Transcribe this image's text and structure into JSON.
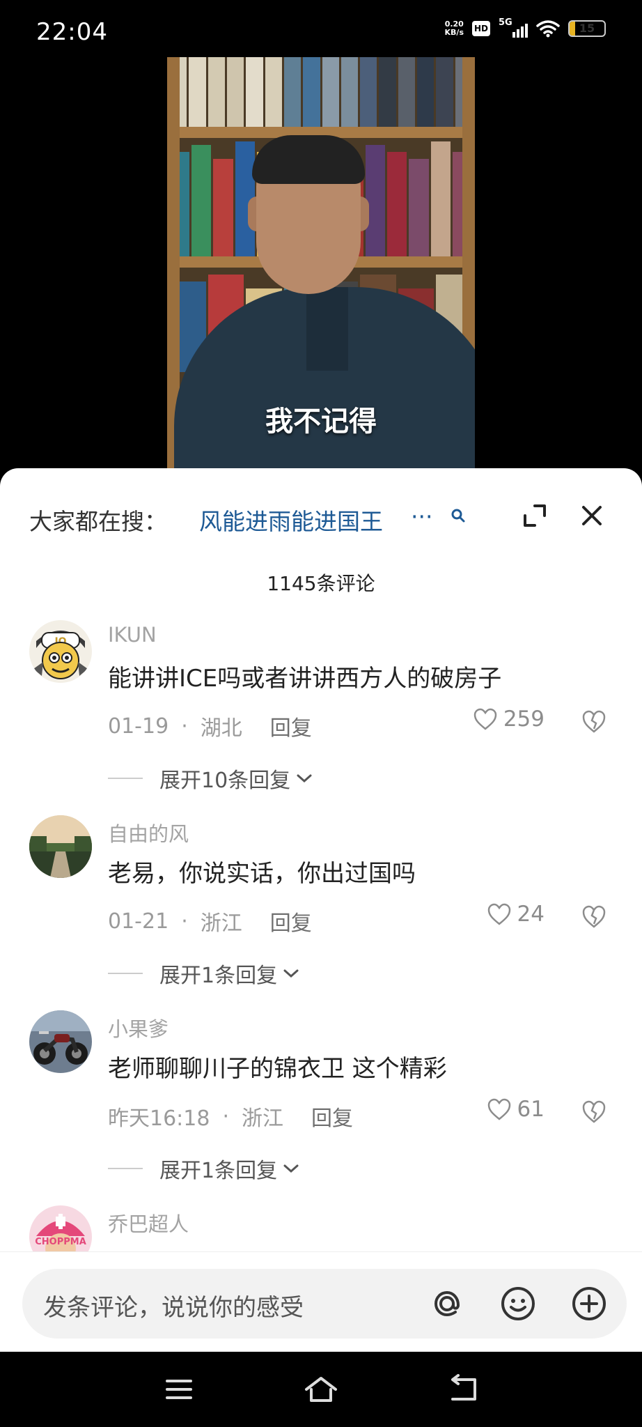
{
  "status_bar": {
    "time": "22:04",
    "net_speed_value": "0.20",
    "net_speed_unit": "KB/s",
    "hd_badge": "HD",
    "network_type": "5G",
    "battery_level": "15",
    "battery_fraction": 0.15,
    "battery_color": "#e8b423"
  },
  "video": {
    "subtitle": "我不记得"
  },
  "search": {
    "prefix": "大家都在搜：",
    "query": "风能进雨能进国王",
    "ellipsis": "···",
    "icon": "search-icon",
    "link_color": "#1e5a95"
  },
  "sheet_controls": {
    "expand_icon": "expand-icon",
    "close_icon": "close-icon"
  },
  "comments_header": {
    "count_label": "1145条评论"
  },
  "comments": [
    {
      "username": "IKUN",
      "avatar_icon": "cartoon-avatar",
      "text": "能讲讲ICE吗或者讲讲西方人的破房子",
      "date": "01-19",
      "dot": "·",
      "location": "湖北",
      "reply_label": "回复",
      "likes": "259",
      "expand_label": "展开10条回复"
    },
    {
      "username": "自由的风",
      "avatar_icon": "sunset-river-avatar",
      "text": "老易，你说实话，你出过国吗",
      "date": "01-21",
      "dot": "·",
      "location": "浙江",
      "reply_label": "回复",
      "likes": "24",
      "expand_label": "展开1条回复"
    },
    {
      "username": "小果爹",
      "avatar_icon": "motorcycle-avatar",
      "text": "老师聊聊川子的锦衣卫 这个精彩",
      "date": "昨天16:18",
      "dot": "·",
      "location": "浙江",
      "reply_label": "回复",
      "likes": "61",
      "expand_label": "展开1条回复"
    },
    {
      "username": "乔巴超人",
      "avatar_icon": "chopper-avatar",
      "avatar_text": "CHOPPMA"
    }
  ],
  "input_bar": {
    "placeholder": "发条评论，说说你的感受",
    "mention_icon": "at-icon",
    "emoji_icon": "emoji-icon",
    "add_icon": "plus-icon"
  },
  "nav_bar": {
    "menu_icon": "menu-icon",
    "home_icon": "home-icon",
    "back_icon": "back-icon"
  }
}
